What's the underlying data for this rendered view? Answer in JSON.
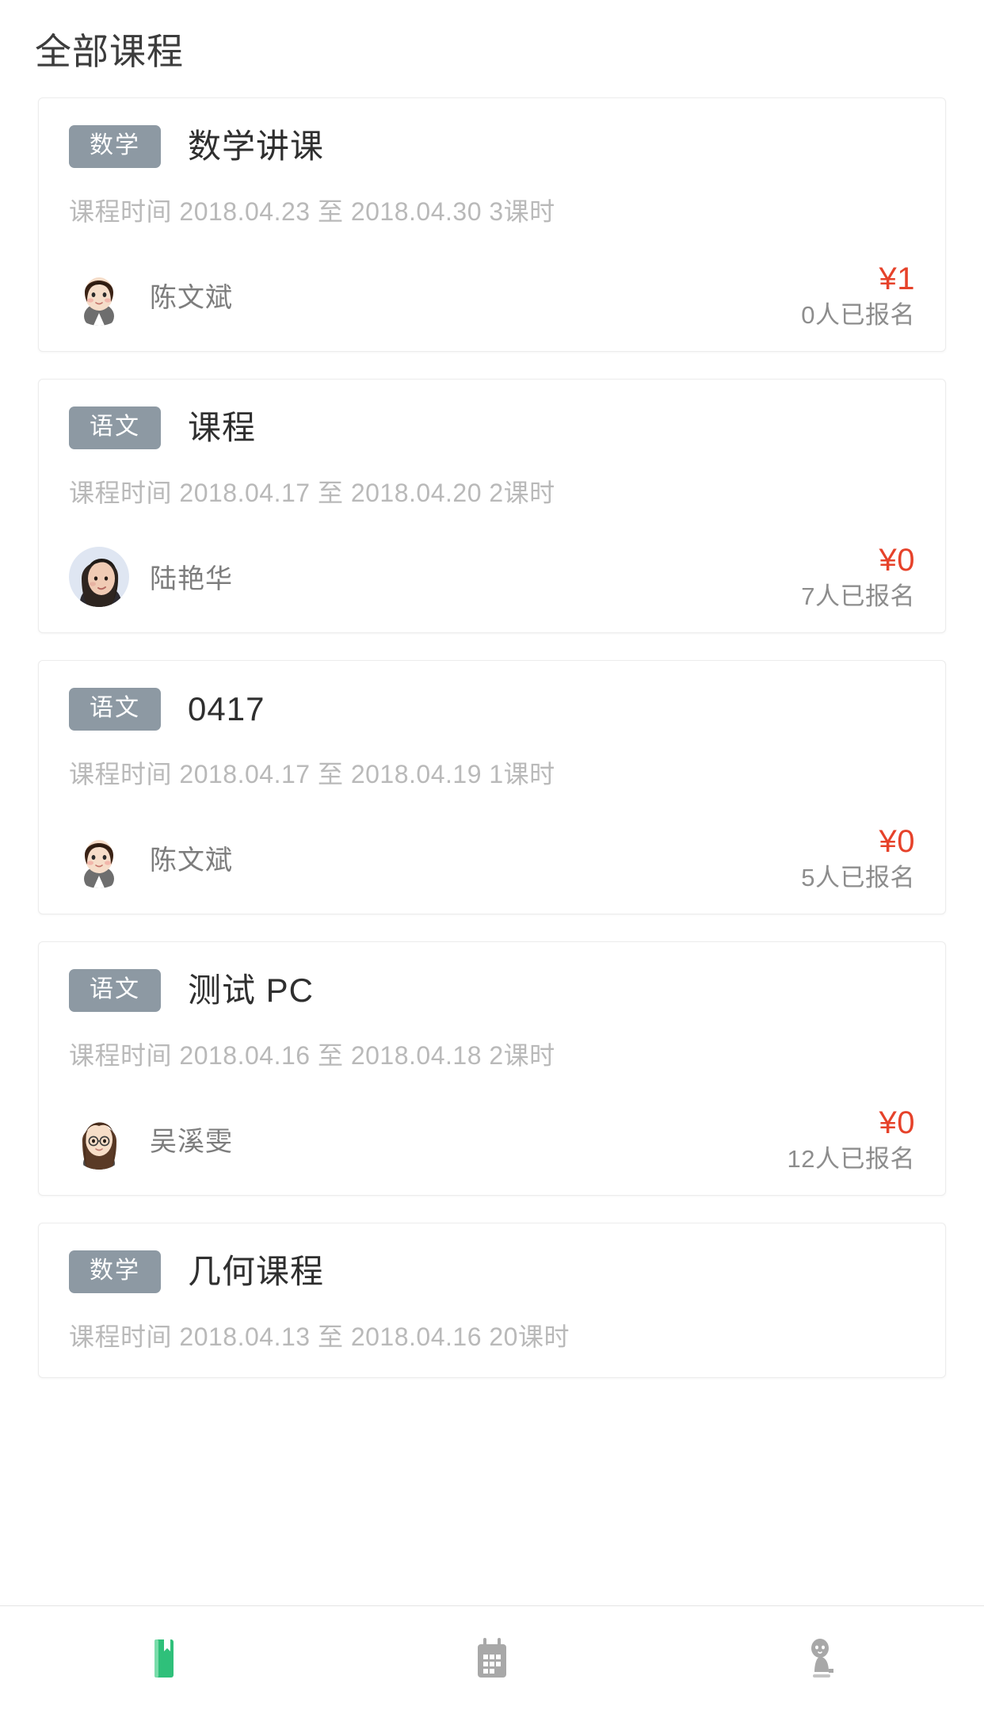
{
  "header": {
    "title": "全部课程"
  },
  "labels": {
    "time_prefix": "课程时间",
    "time_separator": "至",
    "lesson_unit": "课时",
    "enrolled_suffix": "人已报名",
    "currency": "¥"
  },
  "colors": {
    "tag_background": "#8d99a3",
    "price": "#e6422a",
    "title": "#2f2f2f",
    "muted": "#b9b9b9",
    "active_tab": "#2fc07a",
    "inactive_tab": "#a8a8a8"
  },
  "courses": [
    {
      "subject": "数学",
      "title": "数学讲课",
      "time": "课程时间 2018.04.23 至 2018.04.30 3课时",
      "start_date": "2018.04.23",
      "end_date": "2018.04.30",
      "lessons": "3课时",
      "teacher": "陈文斌",
      "avatar": "cartoon-bob-hair-avatar",
      "price": "¥1",
      "enrolled": "0人已报名"
    },
    {
      "subject": "语文",
      "title": "课程",
      "time": "课程时间 2018.04.17 至 2018.04.20 2课时",
      "start_date": "2018.04.17",
      "end_date": "2018.04.20",
      "lessons": "2课时",
      "teacher": "陆艳华",
      "avatar": "photo-portrait-avatar",
      "price": "¥0",
      "enrolled": "7人已报名"
    },
    {
      "subject": "语文",
      "title": "0417",
      "time": "课程时间 2018.04.17 至 2018.04.19 1课时",
      "start_date": "2018.04.17",
      "end_date": "2018.04.19",
      "lessons": "1课时",
      "teacher": "陈文斌",
      "avatar": "cartoon-bob-hair-avatar",
      "price": "¥0",
      "enrolled": "5人已报名"
    },
    {
      "subject": "语文",
      "title": "测试 PC",
      "time": "课程时间 2018.04.16 至 2018.04.18 2课时",
      "start_date": "2018.04.16",
      "end_date": "2018.04.18",
      "lessons": "2课时",
      "teacher": "吴溪雯",
      "avatar": "cartoon-long-hair-glasses-avatar",
      "price": "¥0",
      "enrolled": "12人已报名"
    },
    {
      "subject": "数学",
      "title": "几何课程",
      "time": "课程时间 2018.04.13 至 2018.04.16 20课时",
      "start_date": "2018.04.13",
      "end_date": "2018.04.16",
      "lessons": "20课时",
      "teacher": "",
      "avatar": "",
      "price": "",
      "enrolled": ""
    }
  ],
  "tabbar": {
    "items": [
      {
        "icon": "book-icon",
        "active": true
      },
      {
        "icon": "calendar-icon",
        "active": false
      },
      {
        "icon": "person-icon",
        "active": false
      }
    ]
  }
}
